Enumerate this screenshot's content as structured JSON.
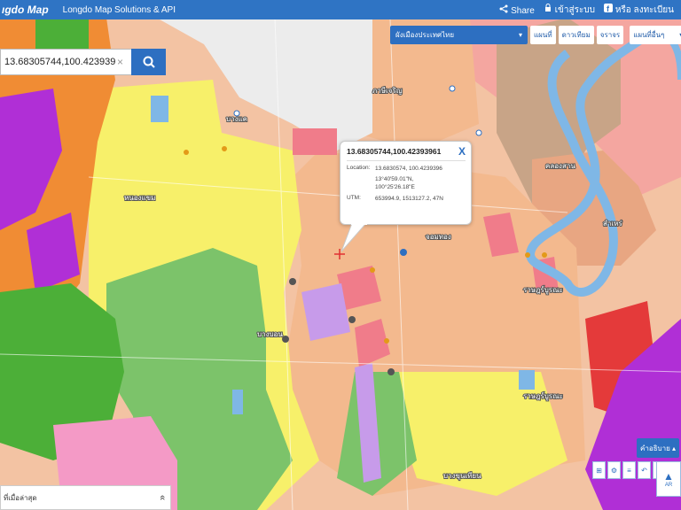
{
  "header": {
    "logo": "ıgdo Map",
    "brand": "Longdo Map Solutions & API",
    "share": "Share",
    "login": "เข้าสู่ระบบ",
    "or_signup": "หรือ ลงทะเบียน"
  },
  "search": {
    "value": "13.68305744,100.42393961",
    "clear": "×"
  },
  "layers": {
    "selected": "ผังเมืองประเทศไทย",
    "buttons": [
      "แผนที่",
      "ดาวเทียม",
      "จราจร"
    ],
    "extra": "แผนที่อื่นๆ"
  },
  "popup": {
    "title": "13.68305744,100.42393961",
    "close": "X",
    "location_label": "Location:",
    "location_decimal": "13.6830574, 100.4239396",
    "location_lat_dms": "13°40'59.01\"N,",
    "location_lon_dms": "100°25'26.18\"E",
    "utm_label": "UTM:",
    "utm_value": "653994.9, 1513127.2, 47N"
  },
  "bottom_bar": {
    "label": "ที่เมื่อล่าสุด",
    "chevron": "«"
  },
  "legend_button": "คำอธิบาย",
  "north": {
    "arrow": "▲",
    "label": "AR"
  },
  "place_labels": [
    "บางแค",
    "หนองแขม",
    "บางบอน",
    "จอมทอง",
    "คลองสาน",
    "ราษฎร์บูรณะ",
    "สำเหร่",
    "ภาษีเจริญ",
    "บางขุนเทียน",
    "ราษฎร์บูรณะ"
  ],
  "tool_icons": [
    "measure-icon",
    "settings-icon",
    "layers-icon",
    "undo-icon",
    "redo-icon",
    "close-icon"
  ],
  "colors": {
    "header": "#2f74c4",
    "accent": "#2d6fc1",
    "residential_low": "#f7f06a",
    "residential_mid": "#f3b98e",
    "residential_high": "#e8a682",
    "commercial": "#f07c8a",
    "agricultural": "#7cc36a",
    "industrial": "#b46de0",
    "river": "#7fb7e6",
    "conservation": "#c8b39c"
  }
}
